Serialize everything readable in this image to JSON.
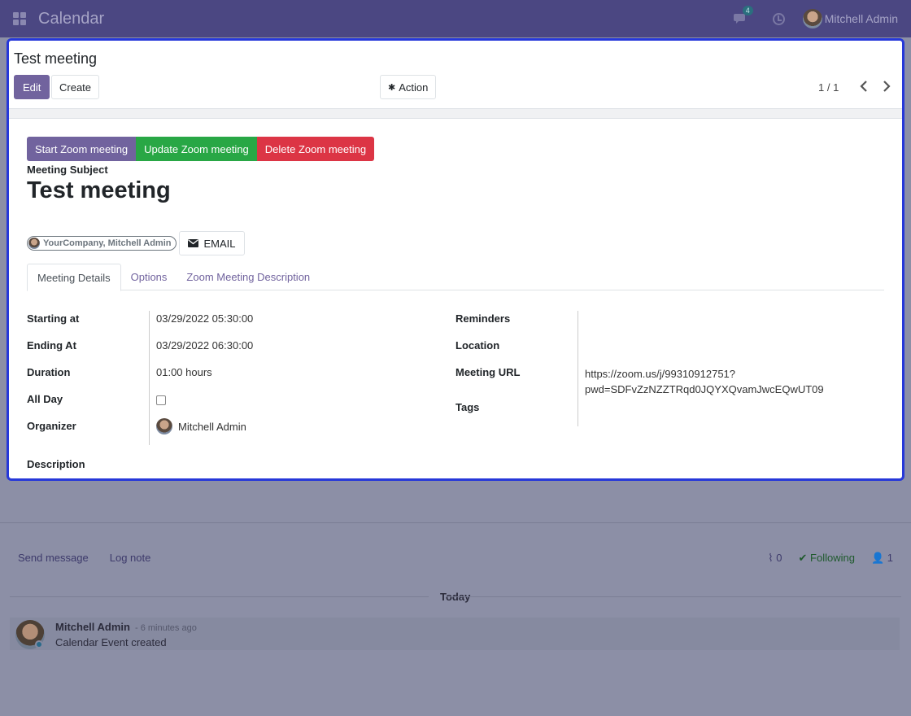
{
  "navbar": {
    "app_title": "Calendar",
    "messages_badge": "4",
    "user_name": "Mitchell Admin"
  },
  "control_panel": {
    "breadcrumb": "Test meeting",
    "edit_label": "Edit",
    "create_label": "Create",
    "action_label": "Action",
    "pager": "1 / 1"
  },
  "zoom": {
    "start_label": "Start Zoom meeting",
    "update_label": "Update Zoom meeting",
    "delete_label": "Delete Zoom meeting"
  },
  "form": {
    "subject_label": "Meeting Subject",
    "subject": "Test meeting",
    "attendee": "YourCompany, Mitchell Admin",
    "email_label": "EMAIL",
    "tabs": [
      "Meeting Details",
      "Options",
      "Zoom Meeting Description"
    ],
    "fields_left": {
      "starting_at_label": "Starting at",
      "starting_at": "03/29/2022 05:30:00",
      "ending_at_label": "Ending At",
      "ending_at": "03/29/2022 06:30:00",
      "duration_label": "Duration",
      "duration": "01:00 hours",
      "all_day_label": "All Day",
      "organizer_label": "Organizer",
      "organizer": "Mitchell Admin"
    },
    "fields_right": {
      "reminders_label": "Reminders",
      "location_label": "Location",
      "meeting_url_label": "Meeting URL",
      "meeting_url": "https://zoom.us/j/99310912751?pwd=SDFvZzNZZTRqd0JQYXQvamJwcEQwUT09",
      "meeting_url_line1": "https://zoom.us/j/99310912751?",
      "meeting_url_line2": "pwd=SDFvZzNZZTRqd0JQYXQvamJwcEQwUT09",
      "tags_label": "Tags"
    },
    "description_label": "Description"
  },
  "chatter": {
    "send_message": "Send message",
    "log_note": "Log note",
    "attachments_count": "0",
    "following_label": "Following",
    "followers_count": "1",
    "date_separator": "Today",
    "message": {
      "author": "Mitchell Admin",
      "time": "- 6 minutes ago",
      "body": "Calendar Event created"
    }
  },
  "colors": {
    "navbar": "#4b4782",
    "primary": "#71639e",
    "success": "#28a745",
    "danger": "#dc3545",
    "dialog_border": "#2638d9"
  }
}
